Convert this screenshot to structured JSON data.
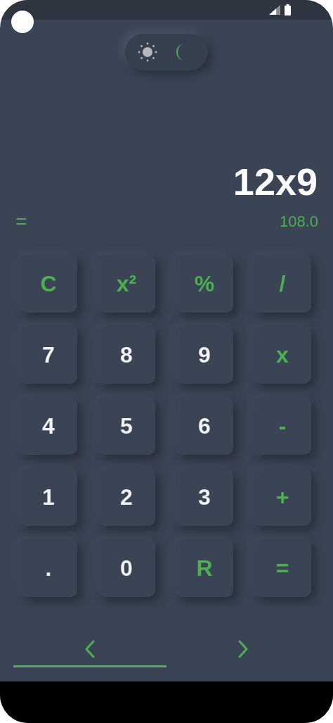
{
  "theme_toggle": [
    {
      "kind": "sun",
      "selected": false
    },
    {
      "kind": "moon",
      "selected": true
    }
  ],
  "display": {
    "expression": "12x9",
    "equals": "=",
    "result": "108.0"
  },
  "keys": [
    {
      "label": "C",
      "kind": "op"
    },
    {
      "label": "x²",
      "kind": "op"
    },
    {
      "label": "%",
      "kind": "op"
    },
    {
      "label": "/",
      "kind": "op"
    },
    {
      "label": "7",
      "kind": "digit"
    },
    {
      "label": "8",
      "kind": "digit"
    },
    {
      "label": "9",
      "kind": "digit"
    },
    {
      "label": "x",
      "kind": "op"
    },
    {
      "label": "4",
      "kind": "digit"
    },
    {
      "label": "5",
      "kind": "digit"
    },
    {
      "label": "6",
      "kind": "digit"
    },
    {
      "label": "-",
      "kind": "op"
    },
    {
      "label": "1",
      "kind": "digit"
    },
    {
      "label": "2",
      "kind": "digit"
    },
    {
      "label": "3",
      "kind": "digit"
    },
    {
      "label": "+",
      "kind": "op"
    },
    {
      "label": ".",
      "kind": "digit"
    },
    {
      "label": "0",
      "kind": "digit"
    },
    {
      "label": "R",
      "kind": "op"
    },
    {
      "label": "=",
      "kind": "op"
    }
  ],
  "nav_tabs": [
    {
      "kind": "back",
      "selected": true
    },
    {
      "kind": "forward",
      "selected": false
    }
  ]
}
